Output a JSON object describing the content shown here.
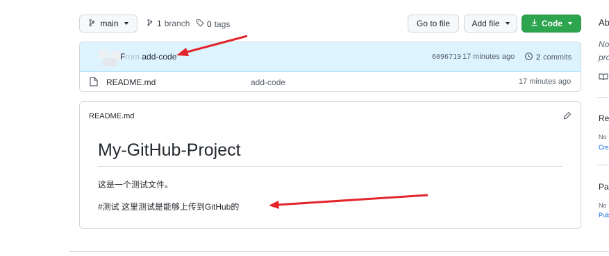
{
  "toolbar": {
    "branch_name": "main",
    "branches_count": "1",
    "branches_label": "branch",
    "tags_count": "0",
    "tags_label": "tags",
    "go_to_file": "Go to file",
    "add_file": "Add file",
    "code": "Code"
  },
  "commit": {
    "message_prefix": "F",
    "message_link": "add-code",
    "sha": "6096719",
    "time": "17 minutes ago",
    "commits_count": "2",
    "commits_label": "commits"
  },
  "files": [
    {
      "name": "README.md",
      "message": "add-code",
      "time": "17 minutes ago"
    }
  ],
  "readme": {
    "header": "README.md",
    "title": "My-GitHub-Project",
    "paragraph1": "这是一个测试文件。",
    "paragraph2": "#测试 这里测试是能够上传到GitHub的"
  },
  "sidebar": {
    "about_heading_partial": "Ab",
    "about_desc_line1": "No",
    "about_desc_line2": "pro",
    "releases_heading_partial": "Re",
    "releases_line1": "No",
    "releases_line2": "Cre",
    "packages_heading_partial": "Pa",
    "packages_line1": "No",
    "packages_line2": "Pub"
  },
  "colors": {
    "accent_green": "#2da44e",
    "link_blue": "#0969da",
    "annotation_red": "#e3242b",
    "commit_bar_bg": "#ddf4ff"
  }
}
